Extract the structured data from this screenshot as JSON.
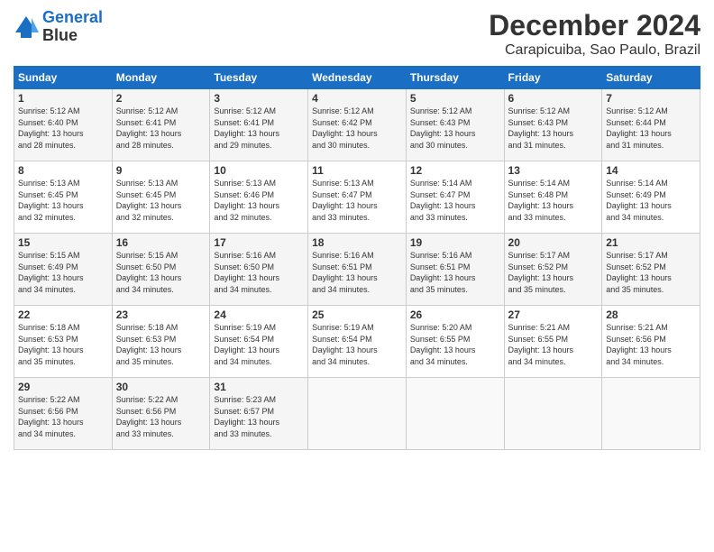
{
  "logo": {
    "line1": "General",
    "line2": "Blue"
  },
  "title": "December 2024",
  "subtitle": "Carapicuiba, Sao Paulo, Brazil",
  "headers": [
    "Sunday",
    "Monday",
    "Tuesday",
    "Wednesday",
    "Thursday",
    "Friday",
    "Saturday"
  ],
  "weeks": [
    [
      {
        "day": "1",
        "sunrise": "5:12 AM",
        "sunset": "6:40 PM",
        "daylight": "13 hours and 28 minutes."
      },
      {
        "day": "2",
        "sunrise": "5:12 AM",
        "sunset": "6:41 PM",
        "daylight": "13 hours and 28 minutes."
      },
      {
        "day": "3",
        "sunrise": "5:12 AM",
        "sunset": "6:41 PM",
        "daylight": "13 hours and 29 minutes."
      },
      {
        "day": "4",
        "sunrise": "5:12 AM",
        "sunset": "6:42 PM",
        "daylight": "13 hours and 30 minutes."
      },
      {
        "day": "5",
        "sunrise": "5:12 AM",
        "sunset": "6:43 PM",
        "daylight": "13 hours and 30 minutes."
      },
      {
        "day": "6",
        "sunrise": "5:12 AM",
        "sunset": "6:43 PM",
        "daylight": "13 hours and 31 minutes."
      },
      {
        "day": "7",
        "sunrise": "5:12 AM",
        "sunset": "6:44 PM",
        "daylight": "13 hours and 31 minutes."
      }
    ],
    [
      {
        "day": "8",
        "sunrise": "5:13 AM",
        "sunset": "6:45 PM",
        "daylight": "13 hours and 32 minutes."
      },
      {
        "day": "9",
        "sunrise": "5:13 AM",
        "sunset": "6:45 PM",
        "daylight": "13 hours and 32 minutes."
      },
      {
        "day": "10",
        "sunrise": "5:13 AM",
        "sunset": "6:46 PM",
        "daylight": "13 hours and 32 minutes."
      },
      {
        "day": "11",
        "sunrise": "5:13 AM",
        "sunset": "6:47 PM",
        "daylight": "13 hours and 33 minutes."
      },
      {
        "day": "12",
        "sunrise": "5:14 AM",
        "sunset": "6:47 PM",
        "daylight": "13 hours and 33 minutes."
      },
      {
        "day": "13",
        "sunrise": "5:14 AM",
        "sunset": "6:48 PM",
        "daylight": "13 hours and 33 minutes."
      },
      {
        "day": "14",
        "sunrise": "5:14 AM",
        "sunset": "6:49 PM",
        "daylight": "13 hours and 34 minutes."
      }
    ],
    [
      {
        "day": "15",
        "sunrise": "5:15 AM",
        "sunset": "6:49 PM",
        "daylight": "13 hours and 34 minutes."
      },
      {
        "day": "16",
        "sunrise": "5:15 AM",
        "sunset": "6:50 PM",
        "daylight": "13 hours and 34 minutes."
      },
      {
        "day": "17",
        "sunrise": "5:16 AM",
        "sunset": "6:50 PM",
        "daylight": "13 hours and 34 minutes."
      },
      {
        "day": "18",
        "sunrise": "5:16 AM",
        "sunset": "6:51 PM",
        "daylight": "13 hours and 34 minutes."
      },
      {
        "day": "19",
        "sunrise": "5:16 AM",
        "sunset": "6:51 PM",
        "daylight": "13 hours and 35 minutes."
      },
      {
        "day": "20",
        "sunrise": "5:17 AM",
        "sunset": "6:52 PM",
        "daylight": "13 hours and 35 minutes."
      },
      {
        "day": "21",
        "sunrise": "5:17 AM",
        "sunset": "6:52 PM",
        "daylight": "13 hours and 35 minutes."
      }
    ],
    [
      {
        "day": "22",
        "sunrise": "5:18 AM",
        "sunset": "6:53 PM",
        "daylight": "13 hours and 35 minutes."
      },
      {
        "day": "23",
        "sunrise": "5:18 AM",
        "sunset": "6:53 PM",
        "daylight": "13 hours and 35 minutes."
      },
      {
        "day": "24",
        "sunrise": "5:19 AM",
        "sunset": "6:54 PM",
        "daylight": "13 hours and 34 minutes."
      },
      {
        "day": "25",
        "sunrise": "5:19 AM",
        "sunset": "6:54 PM",
        "daylight": "13 hours and 34 minutes."
      },
      {
        "day": "26",
        "sunrise": "5:20 AM",
        "sunset": "6:55 PM",
        "daylight": "13 hours and 34 minutes."
      },
      {
        "day": "27",
        "sunrise": "5:21 AM",
        "sunset": "6:55 PM",
        "daylight": "13 hours and 34 minutes."
      },
      {
        "day": "28",
        "sunrise": "5:21 AM",
        "sunset": "6:56 PM",
        "daylight": "13 hours and 34 minutes."
      }
    ],
    [
      {
        "day": "29",
        "sunrise": "5:22 AM",
        "sunset": "6:56 PM",
        "daylight": "13 hours and 34 minutes."
      },
      {
        "day": "30",
        "sunrise": "5:22 AM",
        "sunset": "6:56 PM",
        "daylight": "13 hours and 33 minutes."
      },
      {
        "day": "31",
        "sunrise": "5:23 AM",
        "sunset": "6:57 PM",
        "daylight": "13 hours and 33 minutes."
      },
      null,
      null,
      null,
      null
    ]
  ],
  "labels": {
    "sunrise": "Sunrise: ",
    "sunset": "Sunset: ",
    "daylight": "Daylight: "
  }
}
